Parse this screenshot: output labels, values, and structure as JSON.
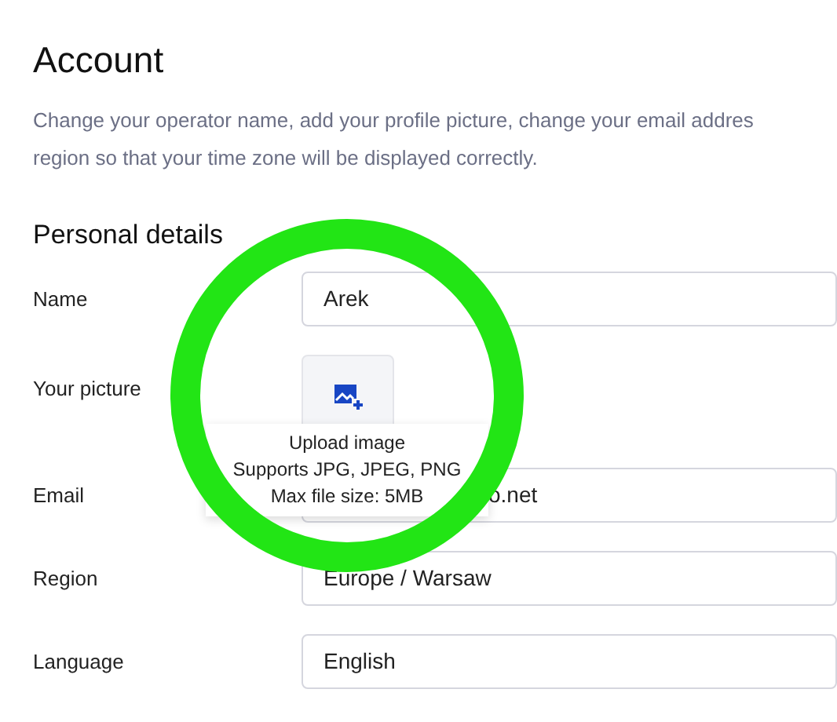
{
  "page": {
    "title": "Account",
    "description_lines": [
      "Change your operator name, add your profile picture, change your email addres",
      "region so that your time zone will be displayed correctly."
    ]
  },
  "section": {
    "title": "Personal details"
  },
  "fields": [
    {
      "kind": "text",
      "label": "Name",
      "value": "Arek"
    },
    {
      "kind": "picture",
      "label": "Your picture"
    },
    {
      "kind": "text",
      "label": "Email",
      "value": "o.net",
      "covered": true
    },
    {
      "kind": "text",
      "label": "Region",
      "value": "Europe / Warsaw"
    },
    {
      "kind": "text",
      "label": "Language",
      "value": "English"
    }
  ],
  "tooltip": {
    "lines": [
      "Upload image",
      "Supports JPG, JPEG, PNG",
      "Max file size: 5MB"
    ]
  },
  "annotation": {
    "kind": "ring",
    "color": "#22e515"
  }
}
